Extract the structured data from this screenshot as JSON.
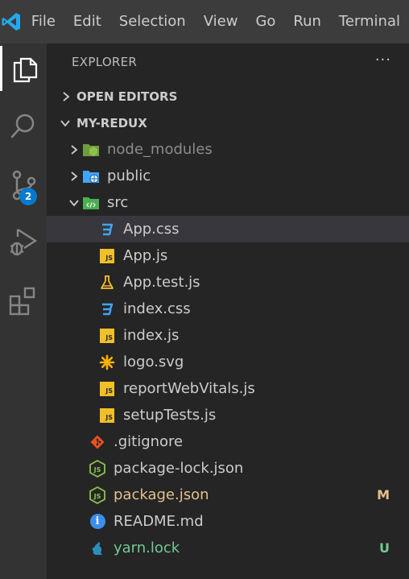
{
  "menu": [
    "File",
    "Edit",
    "Selection",
    "View",
    "Go",
    "Run",
    "Terminal"
  ],
  "activity_bar": {
    "items": [
      "explorer",
      "search",
      "source-control",
      "run-and-debug",
      "extensions"
    ],
    "source_control_badge": "2"
  },
  "explorer": {
    "title": "EXPLORER",
    "more_actions": "···",
    "open_editors_label": "OPEN EDITORS",
    "project_label": "MY-REDUX"
  },
  "files": [
    {
      "name": "node_modules",
      "icon": "node-folder-icon",
      "type": "folder",
      "state": "collapsed"
    },
    {
      "name": "public",
      "icon": "globe-folder-icon",
      "type": "folder",
      "state": "collapsed"
    },
    {
      "name": "src",
      "icon": "src-folder-icon",
      "type": "folder",
      "state": "expanded"
    },
    {
      "name": "App.css",
      "icon": "css-icon",
      "selected": true
    },
    {
      "name": "App.js",
      "icon": "js-icon"
    },
    {
      "name": "App.test.js",
      "icon": "test-flask-icon"
    },
    {
      "name": "index.css",
      "icon": "css-icon"
    },
    {
      "name": "index.js",
      "icon": "js-icon"
    },
    {
      "name": "logo.svg",
      "icon": "svg-icon"
    },
    {
      "name": "reportWebVitals.js",
      "icon": "js-icon"
    },
    {
      "name": "setupTests.js",
      "icon": "js-icon"
    },
    {
      "name": ".gitignore",
      "icon": "git-icon"
    },
    {
      "name": "package-lock.json",
      "icon": "nodejs-icon"
    },
    {
      "name": "package.json",
      "icon": "nodejs-icon",
      "git_status": "M"
    },
    {
      "name": "README.md",
      "icon": "info-icon"
    },
    {
      "name": "yarn.lock",
      "icon": "yarn-icon",
      "git_status": "U"
    }
  ],
  "colors": {
    "titlebar": "#3c3c3c",
    "activity_bar": "#333333",
    "sidebar": "#252526",
    "selected_row": "#37373d",
    "modified": "#e2c08d",
    "untracked": "#73c991",
    "ignored": "#8c8c8c",
    "accent": "#007acc"
  }
}
